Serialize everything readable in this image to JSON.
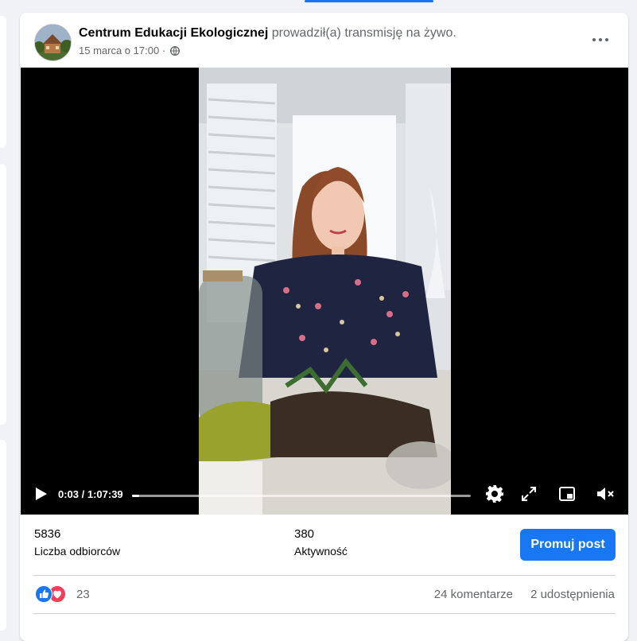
{
  "post": {
    "page_name": "Centrum Edukacji Ekologicznej",
    "action_text": "prowadził(a) transmisję na żywo.",
    "date": "15 marca o 17:00",
    "separator": "·",
    "privacy_icon": "globe-icon",
    "menu_icon": "more-options-icon"
  },
  "video": {
    "time": "0:03 / 1:07:39",
    "progress": 0.0007,
    "icons": [
      "play-icon",
      "settings-icon",
      "fullscreen-icon",
      "picture-in-picture-icon",
      "volume-muted-icon"
    ]
  },
  "stats": {
    "reach_value": "5836",
    "reach_label": "Liczba odbiorców",
    "engagement_value": "380",
    "engagement_label": "Aktywność",
    "promote_label": "Promuj post"
  },
  "reactions": {
    "count": "23",
    "types": [
      "like",
      "love"
    ],
    "comments": "24 komentarze",
    "shares": "2 udostępnienia"
  },
  "colors": {
    "accent": "#1877f2",
    "love": "#f33e58",
    "secondary_text": "#65676b"
  }
}
